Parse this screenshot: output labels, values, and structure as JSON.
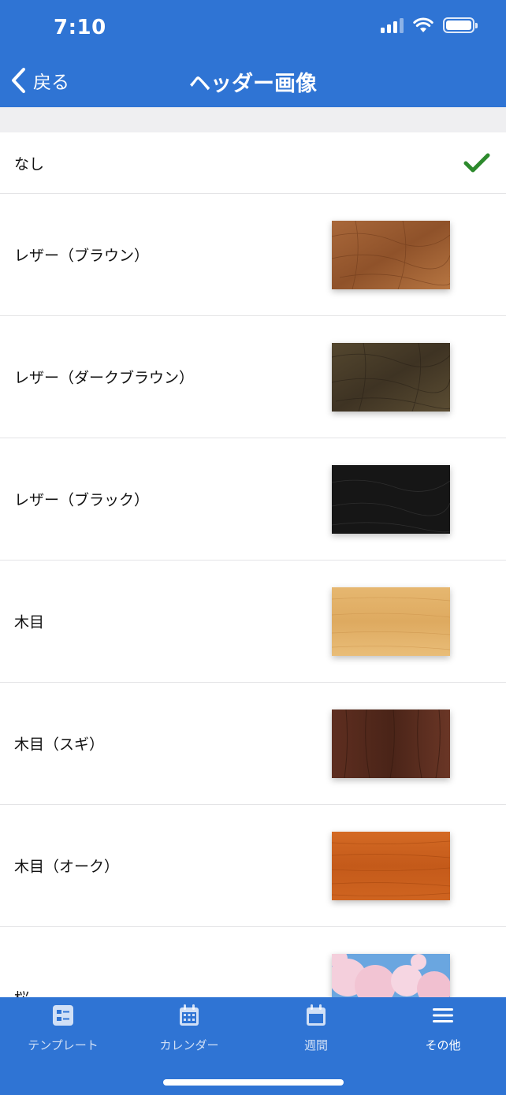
{
  "status_bar": {
    "time": "7:10"
  },
  "nav": {
    "back_label": "戻る",
    "title": "ヘッダー画像"
  },
  "list": {
    "none_label": "なし",
    "items": [
      {
        "label": "レザー（ブラウン）",
        "swatch": "leather-brown",
        "color": "#9b5a2f"
      },
      {
        "label": "レザー（ダークブラウン）",
        "swatch": "leather-dark-brown",
        "color": "#4b3f2c"
      },
      {
        "label": "レザー（ブラック）",
        "swatch": "leather-black",
        "color": "#151515"
      },
      {
        "label": "木目",
        "swatch": "wood-light",
        "color": "#e2b06a"
      },
      {
        "label": "木目（スギ）",
        "swatch": "wood-cedar",
        "color": "#5a2c1f"
      },
      {
        "label": "木目（オーク）",
        "swatch": "wood-oak",
        "color": "#c9601f"
      },
      {
        "label": "桜",
        "swatch": "cherry-blossom",
        "color": "#f3c9d7"
      }
    ]
  },
  "tabs": [
    {
      "label": "テンプレート",
      "icon": "template-icon"
    },
    {
      "label": "カレンダー",
      "icon": "calendar-icon"
    },
    {
      "label": "週間",
      "icon": "week-icon"
    },
    {
      "label": "その他",
      "icon": "menu-icon",
      "active": true
    }
  ],
  "colors": {
    "brand": "#2f74d4",
    "check": "#2d8a2d",
    "separator": "#e4e4e6"
  }
}
